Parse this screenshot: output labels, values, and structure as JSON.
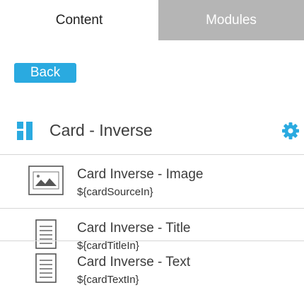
{
  "tabs": [
    {
      "label": "Content",
      "active": true
    },
    {
      "label": "Modules",
      "active": false
    }
  ],
  "back_button": {
    "label": "Back"
  },
  "module": {
    "title": "Card - Inverse",
    "icon": "module-blocks-icon",
    "settings_icon": "gear-icon"
  },
  "items": [
    {
      "title": "Card Inverse - Image",
      "subtitle": "${cardSourceIn}",
      "icon": "image-icon"
    },
    {
      "title": "Card Inverse - Title",
      "subtitle": "${cardTitleIn}",
      "icon": "text-doc-icon"
    },
    {
      "title": "Card Inverse - Text",
      "subtitle": "${cardTextIn}",
      "icon": "text-doc-icon"
    }
  ],
  "colors": {
    "accent": "#2aaae0",
    "inactive_tab": "#b5b5b5",
    "divider": "#d6d6d6"
  }
}
